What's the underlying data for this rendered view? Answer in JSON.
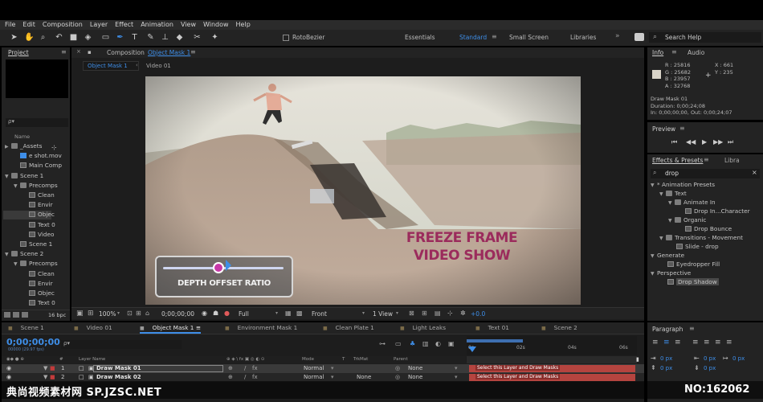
{
  "menu": [
    "File",
    "Edit",
    "Composition",
    "Layer",
    "Effect",
    "Animation",
    "View",
    "Window",
    "Help"
  ],
  "toolbar": {
    "rotobezier": "RotoBezier",
    "workspaces": [
      "Essentials",
      "Standard",
      "Small Screen",
      "Libraries"
    ],
    "active_workspace": "Standard",
    "search_help": "Search Help"
  },
  "project": {
    "tab": "Project",
    "column_name": "Name",
    "search_placeholder": "ρ▾",
    "items": [
      {
        "label": "_Assets",
        "type": "folder",
        "indent": 0,
        "open": false
      },
      {
        "label": "e shot.mov",
        "type": "footage",
        "indent": 1,
        "open": null
      },
      {
        "label": "Main Comp",
        "type": "comp",
        "indent": 1,
        "open": null
      },
      {
        "label": "Scene 1",
        "type": "folder",
        "indent": 0,
        "open": true
      },
      {
        "label": "Precomps",
        "type": "folder",
        "indent": 1,
        "open": true
      },
      {
        "label": "Clean",
        "type": "comp",
        "indent": 2,
        "open": null
      },
      {
        "label": "Envir",
        "type": "comp",
        "indent": 2,
        "open": null
      },
      {
        "label": "Objec",
        "type": "comp",
        "indent": 2,
        "open": null,
        "selected": true
      },
      {
        "label": "Text 0",
        "type": "comp",
        "indent": 2,
        "open": null
      },
      {
        "label": "Video",
        "type": "comp",
        "indent": 2,
        "open": null
      },
      {
        "label": "Scene 1",
        "type": "comp",
        "indent": 1,
        "open": null
      },
      {
        "label": "Scene 2",
        "type": "folder",
        "indent": 0,
        "open": true
      },
      {
        "label": "Precomps",
        "type": "folder",
        "indent": 1,
        "open": true
      },
      {
        "label": "Clean",
        "type": "comp",
        "indent": 2,
        "open": null
      },
      {
        "label": "Envir",
        "type": "comp",
        "indent": 2,
        "open": null
      },
      {
        "label": "Objec",
        "type": "comp",
        "indent": 2,
        "open": null
      },
      {
        "label": "Text 0",
        "type": "comp",
        "indent": 2,
        "open": null
      }
    ],
    "bpc": "16 bpc"
  },
  "composition": {
    "label": "Composition",
    "name": "Object Mask 1",
    "subtabs": [
      "Object Mask 1",
      "Video 01"
    ],
    "overlay_text_line1": "FREEZE FRAME",
    "overlay_text_line2": "VIDEO SHOW",
    "slider_label": "DEPTH OFFSET RATIO",
    "footer": {
      "zoom": "100%",
      "timecode": "0;00;00;00",
      "resolution": "Full",
      "view": "Front",
      "views": "1 View",
      "exposure": "+0.0"
    }
  },
  "info": {
    "tabs": [
      "Info",
      "Audio"
    ],
    "r": "R : 25816",
    "g": "G : 25682",
    "b": "B : 23957",
    "a": "A : 32768",
    "x": "X : 661",
    "y": "Y : 235",
    "layer": "Draw Mask 01",
    "duration": "Duration: 0;00;24;08",
    "in_out": "In: 0;00;00;00, Out: 0;00;24;07"
  },
  "preview": {
    "title": "Preview"
  },
  "effects": {
    "tabs": [
      "Effects & Presets",
      "Libra"
    ],
    "search": "drop",
    "items": [
      {
        "label": "* Animation Presets",
        "indent": 0,
        "kind": "folder-open"
      },
      {
        "label": "Text",
        "indent": 1,
        "kind": "folder-open"
      },
      {
        "label": "Animate In",
        "indent": 2,
        "kind": "folder-open"
      },
      {
        "label": "Drop In...Character",
        "indent": 3,
        "kind": "preset"
      },
      {
        "label": "Organic",
        "indent": 2,
        "kind": "folder-open"
      },
      {
        "label": "Drop Bounce",
        "indent": 3,
        "kind": "preset"
      },
      {
        "label": "Transitions - Movement",
        "indent": 1,
        "kind": "folder-open"
      },
      {
        "label": "Slide - drop",
        "indent": 2,
        "kind": "preset"
      },
      {
        "label": "Generate",
        "indent": 0,
        "kind": "folder-open"
      },
      {
        "label": "Eyedropper Fill",
        "indent": 1,
        "kind": "effect"
      },
      {
        "label": "Perspective",
        "indent": 0,
        "kind": "folder-open"
      },
      {
        "label": "Drop Shadow",
        "indent": 1,
        "kind": "effect",
        "selected": true
      }
    ]
  },
  "timeline": {
    "tabs": [
      "Scene 1",
      "Video 01",
      "Object Mask 1",
      "Environment Mask 1",
      "Clean Plate 1",
      "Light Leaks",
      "Text 01",
      "Scene 2"
    ],
    "active_tab": "Object Mask 1",
    "timecode": "0;00;00;00",
    "timecode_sub": "00000 (29.97 fps)",
    "columns": {
      "layer_name": "Layer Name",
      "mode": "Mode",
      "trkmat": "TrkMat",
      "parent": "Parent"
    },
    "ruler": [
      "0s",
      "02s",
      "04s",
      "06s"
    ],
    "layers": [
      {
        "num": "1",
        "name": "Draw Mask 01",
        "mode": "Normal",
        "trkmat": "",
        "parent": "None",
        "bar_text": "Select this Layer and Draw Masks",
        "selected": true
      },
      {
        "num": "2",
        "name": "Draw Mask 02",
        "mode": "Normal",
        "trkmat": "None",
        "parent": "None",
        "bar_text": "Select this Layer and Draw Masks",
        "selected": false
      }
    ]
  },
  "paragraph": {
    "title": "Paragraph",
    "values": [
      "0 px",
      "0 px",
      "0 px",
      "0 px",
      "0 px"
    ]
  },
  "watermark": {
    "left": "典尚视频素材网 SP.JZSC.NET",
    "right": "NO:162062"
  },
  "colors": {
    "accent": "#3e8ee8",
    "bar_red": "#b5443f",
    "layer_red": "#c23b3b"
  }
}
